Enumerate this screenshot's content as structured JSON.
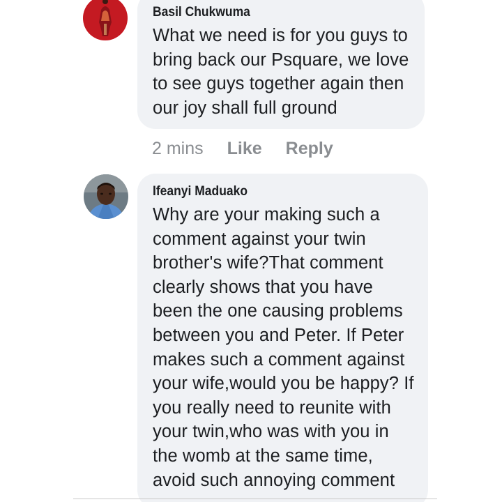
{
  "comments": [
    {
      "author": "Basil Chukwuma",
      "text": "What we need is for you guys to\nbring back our Psquare, we love\nto see guys together again then\nour joy shall full ground",
      "avatar_icon": "avatar-woman-red-dress",
      "actions": {
        "time": "2 mins",
        "like": "Like",
        "reply": "Reply"
      }
    },
    {
      "author": "Ifeanyi Maduako",
      "text": "Why are your making such a\ncomment against your twin\nbrother's wife?That comment\nclearly shows that you have\nbeen the one causing problems\nbetween you and Peter. If Peter\nmakes such a comment against\nyour wife,would you be happy? If\nyou really need to reunite with\nyour twin,who was with you in\nthe womb at the same time,\navoid such annoying comment",
      "avatar_icon": "avatar-man-photo"
    }
  ],
  "colors": {
    "bubble_bg": "#f0f2f5",
    "text": "#1c1e21",
    "meta": "#8a8d91"
  }
}
